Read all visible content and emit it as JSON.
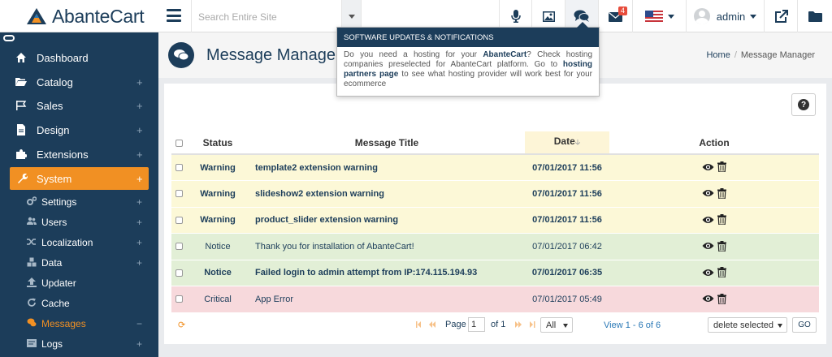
{
  "app": {
    "name": "AbanteCart"
  },
  "colors": {
    "navy": "#1c3d5a",
    "orange": "#f19023",
    "warning_row": "#fcf8d7",
    "notice_row": "#e2efd6",
    "critical_row": "#f7d9dc",
    "badge": "#e74c3c"
  },
  "topbar": {
    "search_placeholder": "Search Entire Site",
    "icons": [
      "menu-icon",
      "microphone-icon",
      "image-icon",
      "chat-bubbles-icon",
      "envelope-icon",
      "us-flag-icon",
      "user-avatar-icon",
      "external-link-icon",
      "folder-icon"
    ],
    "mail_badge": "4",
    "user_name": "admin"
  },
  "sidebar": {
    "items": [
      {
        "label": "Dashboard",
        "icon": "home-icon",
        "expandable": false
      },
      {
        "label": "Catalog",
        "icon": "folder-open-icon",
        "expandable": true
      },
      {
        "label": "Sales",
        "icon": "flag-icon",
        "expandable": true
      },
      {
        "label": "Design",
        "icon": "file-icon",
        "expandable": true
      },
      {
        "label": "Extensions",
        "icon": "puzzle-icon",
        "expandable": true
      },
      {
        "label": "System",
        "icon": "wrench-icon",
        "expandable": true,
        "active": true
      }
    ],
    "sub_items": [
      {
        "label": "Settings",
        "icon": "cogs-icon",
        "expandable": true
      },
      {
        "label": "Users",
        "icon": "users-icon",
        "expandable": true
      },
      {
        "label": "Localization",
        "icon": "random-icon",
        "expandable": true
      },
      {
        "label": "Data",
        "icon": "cubes-icon",
        "expandable": true
      },
      {
        "label": "Updater",
        "icon": "upload-icon",
        "expandable": false
      },
      {
        "label": "Cache",
        "icon": "refresh-icon",
        "expandable": false
      },
      {
        "label": "Messages",
        "icon": "comments-icon",
        "expandable": true,
        "current": true,
        "toggle": "−"
      },
      {
        "label": "Logs",
        "icon": "log-icon",
        "expandable": true
      }
    ]
  },
  "page": {
    "title": "Message Manager",
    "breadcrumb": [
      "Home",
      "Message Manager"
    ]
  },
  "tooltip": {
    "heading": "SOFTWARE UPDATES & NOTIFICATIONS",
    "text_1": "Do you need a hosting for your ",
    "text_bold_1": "AbanteCart",
    "text_2": "? Check hosting companies preselected for AbanteCart platform. Go to ",
    "text_bold_2": "hosting partners page",
    "text_3": " to see what hosting provider will work best for your ecommerce"
  },
  "grid": {
    "columns": {
      "status": "Status",
      "title": "Message Title",
      "date": "Date",
      "action": "Action"
    },
    "rows": [
      {
        "status": "Warning",
        "title": "template2 extension warning",
        "date": "07/01/2017 11:56",
        "type": "warning"
      },
      {
        "status": "Warning",
        "title": "slideshow2 extension warning",
        "date": "07/01/2017 11:56",
        "type": "warning"
      },
      {
        "status": "Warning",
        "title": "product_slider extension warning",
        "date": "07/01/2017 11:56",
        "type": "warning"
      },
      {
        "status": "Notice",
        "title": "Thank you for installation of AbanteCart!",
        "date": "07/01/2017 06:42",
        "type": "notice"
      },
      {
        "status": "Notice",
        "title": "Failed login to admin attempt from IP:174.115.194.93",
        "date": "07/01/2017 06:35",
        "type": "notice-bold"
      },
      {
        "status": "Critical",
        "title": "App Error",
        "date": "07/01/2017 05:49",
        "type": "critical"
      }
    ]
  },
  "pager": {
    "page_label": "Page",
    "page_value": "1",
    "of_label": "of 1",
    "per_page": "All",
    "view_text": "View 1 - 6 of 6",
    "bulk_action": "delete selected",
    "go_label": "GO"
  }
}
